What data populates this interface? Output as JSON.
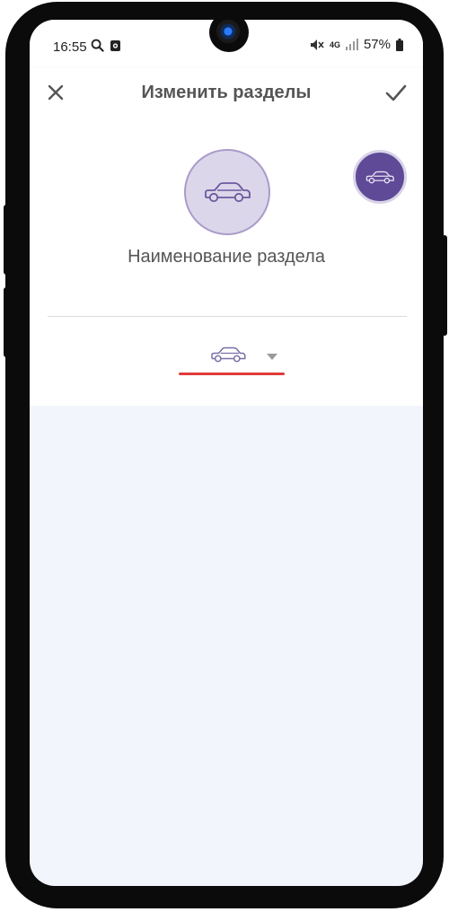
{
  "statusbar": {
    "time": "16:55",
    "network": "4G",
    "battery": "57%"
  },
  "appbar": {
    "title": "Изменить разделы"
  },
  "section": {
    "name": "Наименование раздела",
    "icon": "car-icon"
  },
  "colors": {
    "accent": "#5e4a96",
    "light_accent": "#dcd6ea",
    "underline": "#e03a3a",
    "background": "#f2f6fc"
  }
}
